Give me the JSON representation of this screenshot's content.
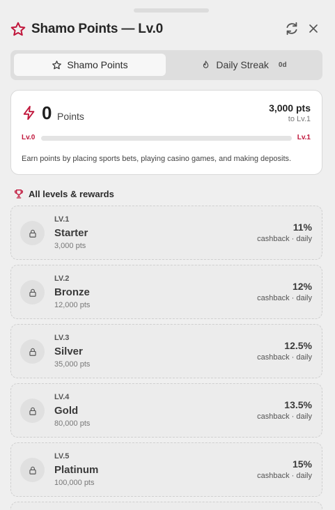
{
  "header": {
    "title": "Shamo Points — Lv.0"
  },
  "tabs": [
    {
      "label": "Shamo Points",
      "icon": "star-icon",
      "active": true
    },
    {
      "label": "Daily Streak",
      "icon": "flame-icon",
      "badge": "0d",
      "active": false
    }
  ],
  "points": {
    "value": "0",
    "unit": "Points",
    "next_target": "3,000 pts",
    "next_level": "to Lv.1",
    "level_from": "Lv.0",
    "level_to": "Lv.1",
    "progress_fraction": 0.0,
    "description": "Earn points by placing sports bets, playing casino games, and making deposits."
  },
  "levels_section": {
    "title": "All levels & rewards"
  },
  "levels": [
    {
      "code": "LV.1",
      "name": "Starter",
      "pts": "3,000 pts",
      "pct": "11%",
      "cashback": "cashback · daily"
    },
    {
      "code": "LV.2",
      "name": "Bronze",
      "pts": "12,000 pts",
      "pct": "12%",
      "cashback": "cashback · daily"
    },
    {
      "code": "LV.3",
      "name": "Silver",
      "pts": "35,000 pts",
      "pct": "12.5%",
      "cashback": "cashback · daily"
    },
    {
      "code": "LV.4",
      "name": "Gold",
      "pts": "80,000 pts",
      "pct": "13.5%",
      "cashback": "cashback · daily"
    },
    {
      "code": "LV.5",
      "name": "Platinum",
      "pts": "100,000 pts",
      "pct": "15%",
      "cashback": "cashback · daily"
    }
  ],
  "colors": {
    "accent": "#c0163b",
    "background": "#efefef",
    "card": "#ffffff"
  }
}
